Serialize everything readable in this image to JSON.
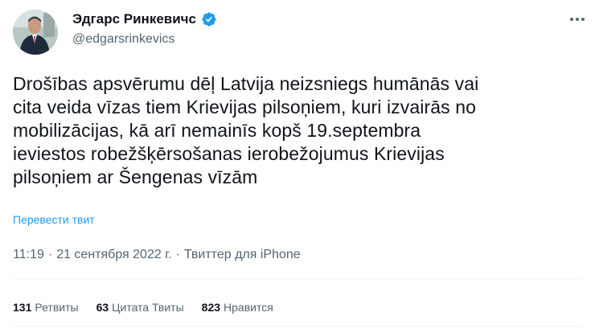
{
  "author": {
    "display_name": "Эдгарс Ринкевичс",
    "handle": "@edgarsrinkevics",
    "verified": true
  },
  "tweet": {
    "lines": [
      "Drošības apsvērumu dēļ Latvija neizsniegs humānās vai",
      "cita veida vīzas tiem Krievijas pilsoņiem, kuri izvairās no",
      "mobilizācijas, kā arī nemainīs kopš 19.septembra",
      "ieviestos robežšķērsošanas ierobežojumus Krievijas",
      "pilsoņiem ar Šengenas vīzām"
    ],
    "translate_label": "Перевести твит",
    "time": "11:19",
    "separator": "·",
    "date": "21 сентября 2022 г.",
    "source": "Твиттер для iPhone"
  },
  "stats": {
    "retweets_count": "131",
    "retweets_label": "Ретвиты",
    "quotes_count": "63",
    "quotes_label": "Цитата Твиты",
    "likes_count": "823",
    "likes_label": "Нравится"
  },
  "colors": {
    "accent": "#1d9bf0",
    "secondary_text": "#536471",
    "primary_text": "#0f1419"
  }
}
